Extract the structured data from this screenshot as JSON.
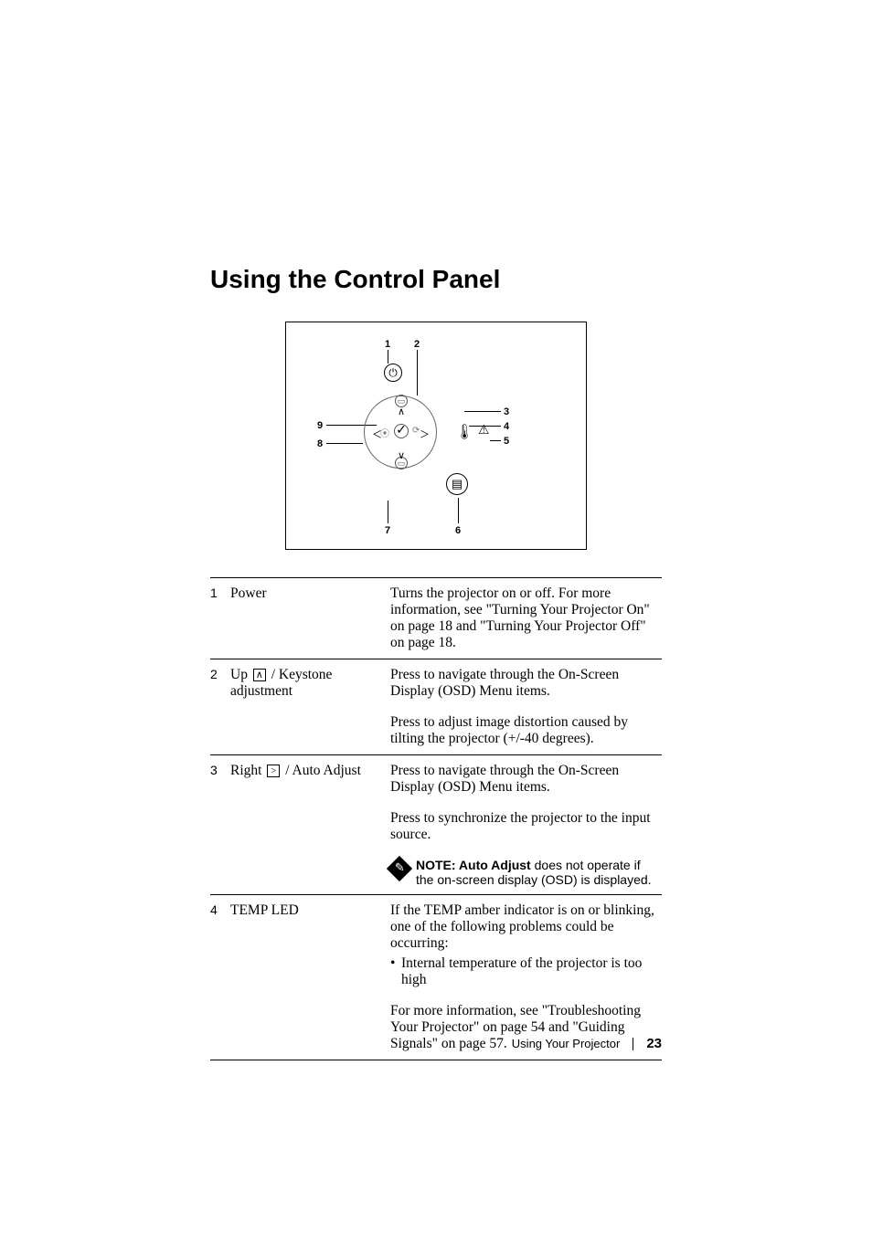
{
  "heading": "Using the Control Panel",
  "diagram": {
    "labels": {
      "n1": "1",
      "n2": "2",
      "n3": "3",
      "n4": "4",
      "n5": "5",
      "n6": "6",
      "n7": "7",
      "n8": "8",
      "n9": "9"
    }
  },
  "rows": [
    {
      "num": "1",
      "label": "Power",
      "desc": "Turns the projector on or off. For more information, see \"Turning Your Projector On\" on page 18 and \"Turning Your Projector Off\" on page 18."
    },
    {
      "num": "2",
      "label_pre": "Up ",
      "label_icon": "∧",
      "label_post": " / Keystone adjustment",
      "desc": "Press to navigate through the On-Screen Display (OSD) Menu items.",
      "desc2": "Press to adjust image distortion caused by tilting the projector (+/-40 degrees)."
    },
    {
      "num": "3",
      "label_pre": "Right ",
      "label_icon": ">",
      "label_post": " / Auto Adjust",
      "desc": "Press to navigate through the On-Screen Display (OSD) Menu items.",
      "desc2": "Press to synchronize the projector to the input source.",
      "note_bold": "NOTE: ",
      "note_strong": "Auto Adjust",
      "note_rest": " does not operate if the on-screen display (OSD) is displayed."
    },
    {
      "num": "4",
      "label": "TEMP LED",
      "desc": "If the TEMP amber indicator is on or blinking, one of the following problems could be occurring:",
      "bullet": "Internal temperature of the projector is too high",
      "desc3": "For more information, see \"Troubleshooting Your Projector\" on page 54 and \"Guiding Signals\" on page 57."
    }
  ],
  "footer": {
    "section": "Using Your Projector",
    "page": "23"
  }
}
